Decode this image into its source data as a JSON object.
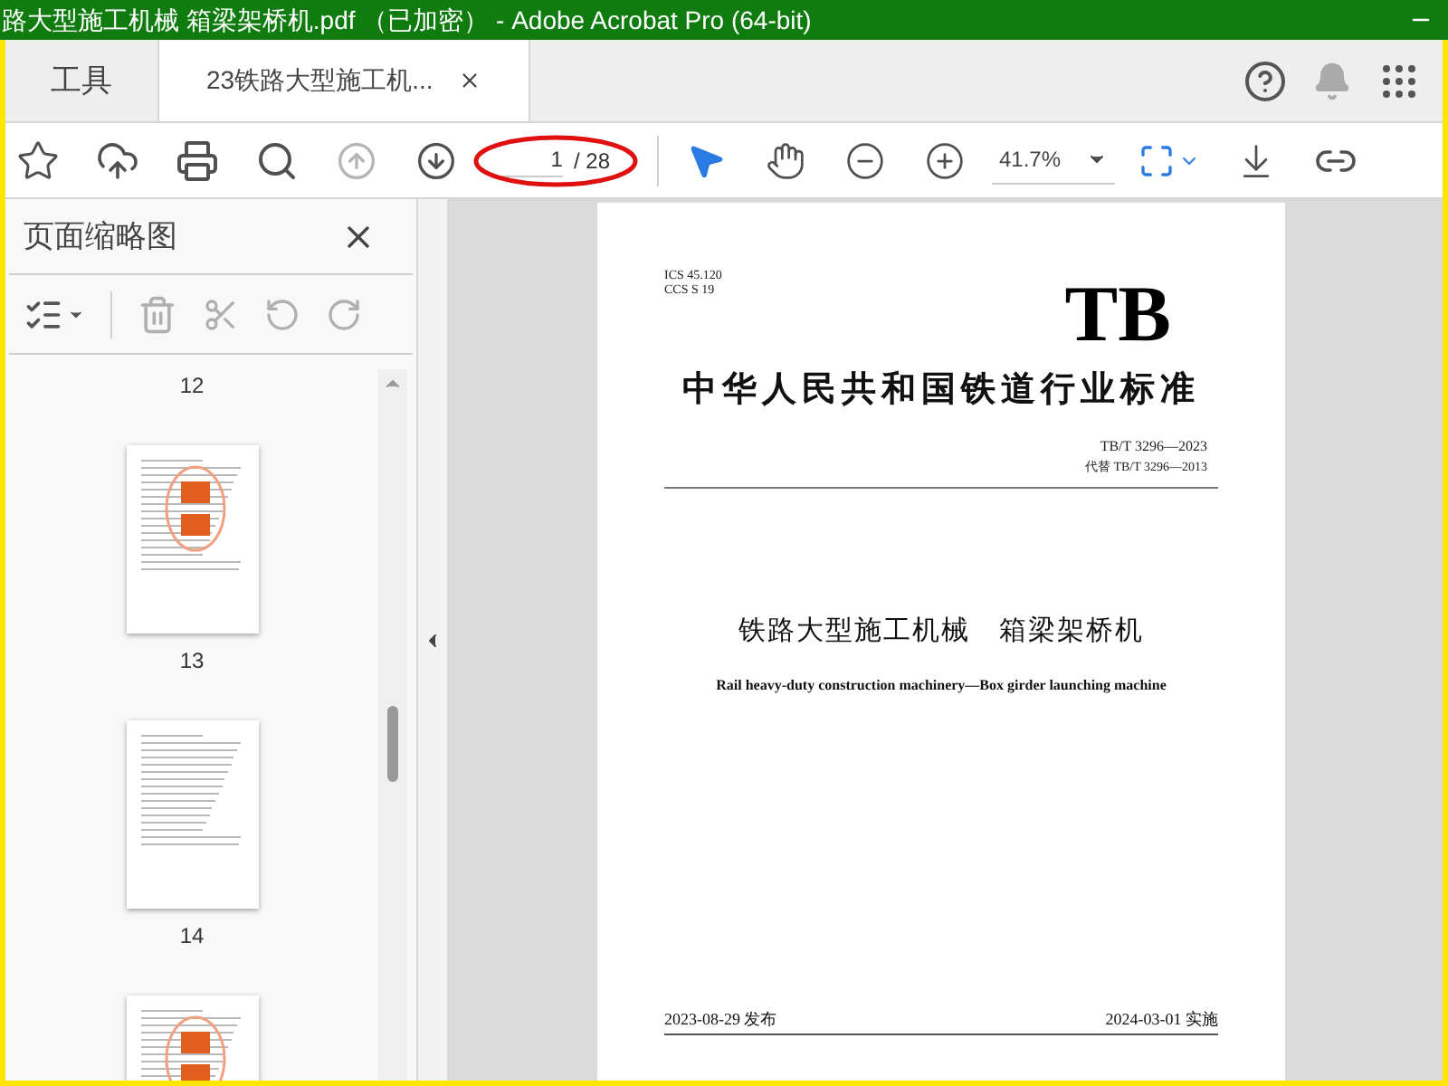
{
  "window": {
    "title": "路大型施工机械 箱梁架桥机.pdf （已加密） - Adobe Acrobat Pro (64-bit)"
  },
  "tabs": [
    {
      "label": "工具",
      "selected": false,
      "closable": false
    },
    {
      "label": "23铁路大型施工机...",
      "selected": true,
      "closable": true
    }
  ],
  "toolbar": {
    "previous_page_disabled": true,
    "page_number": "1",
    "page_count": "/ 28",
    "selection_tool_active": true,
    "zoom": "41.7%"
  },
  "sidebar": {
    "title": "页面缩略图",
    "items": [
      {
        "kind": "label",
        "text": "12"
      },
      {
        "kind": "page",
        "stamp": true
      },
      {
        "kind": "label",
        "text": "13"
      },
      {
        "kind": "page",
        "stamp": false
      },
      {
        "kind": "label",
        "text": "14"
      },
      {
        "kind": "page",
        "stamp": true
      }
    ]
  },
  "document": {
    "ics": "ICS 45.120",
    "ccs": "CCS S 19",
    "logo": "TB",
    "heading": "中华人民共和国铁道行业标准",
    "code": "TB/T 3296—2023",
    "replaces": "代替 TB/T 3296—2013",
    "title_zh": "铁路大型施工机械　箱梁架桥机",
    "title_en": "Rail heavy-duty construction machinery—Box girder launching machine",
    "issue_date": "2023-08-29 发布",
    "effective_date": "2024-03-01 实施"
  }
}
